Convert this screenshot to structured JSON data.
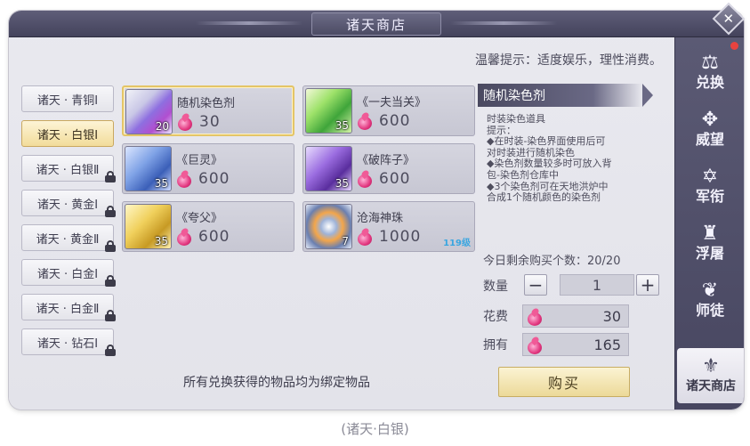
{
  "window": {
    "title": "诸天商店",
    "close_label": "✕"
  },
  "tip": "温馨提示：适度娱乐，理性消费。",
  "tiers": [
    {
      "label": "诸天 · 青铜Ⅰ",
      "locked": false,
      "active": false
    },
    {
      "label": "诸天 · 白银Ⅰ",
      "locked": false,
      "active": true
    },
    {
      "label": "诸天 · 白银Ⅱ",
      "locked": true,
      "active": false
    },
    {
      "label": "诸天 · 黄金Ⅰ",
      "locked": true,
      "active": false
    },
    {
      "label": "诸天 · 黄金Ⅱ",
      "locked": true,
      "active": false
    },
    {
      "label": "诸天 · 白金Ⅰ",
      "locked": true,
      "active": false
    },
    {
      "label": "诸天 · 白金Ⅱ",
      "locked": true,
      "active": false
    },
    {
      "label": "诸天 · 钻石Ⅰ",
      "locked": true,
      "active": false
    }
  ],
  "items": [
    {
      "name": "随机染色剂",
      "price": "30",
      "count": "20",
      "icon": "dye-potion-icon",
      "selected": true
    },
    {
      "name": "《一夫当关》",
      "price": "600",
      "count": "35",
      "icon": "green-book-icon",
      "selected": false
    },
    {
      "name": "《巨灵》",
      "price": "600",
      "count": "35",
      "icon": "blue-book-icon",
      "selected": false
    },
    {
      "name": "《破阵子》",
      "price": "600",
      "count": "35",
      "icon": "purple-book-icon",
      "selected": false
    },
    {
      "name": "《夸父》",
      "price": "600",
      "count": "35",
      "icon": "gold-book-icon",
      "selected": false
    },
    {
      "name": "沧海神珠",
      "price": "1000",
      "count": "7",
      "icon": "pearl-icon",
      "level": "119级",
      "selected": false
    }
  ],
  "detail": {
    "name": "随机染色剂",
    "description": [
      "时装染色道具",
      "提示：",
      "◆在时装-染色界面使用后可",
      "对时装进行随机染色",
      "◆染色剂数量较多时可放入背",
      "包-染色剂仓库中",
      "◆3个染色剂可在天地洪炉中",
      "合成1个随机颜色的染色剂"
    ],
    "remaining": "今日剩余购买个数：20/20",
    "qty_label": "数量",
    "qty_value": "1",
    "minus": "−",
    "plus": "+",
    "cost_label": "花费",
    "cost_value": "30",
    "own_label": "拥有",
    "own_value": "165"
  },
  "footer_note": "所有兑换获得的物品均为绑定物品",
  "buy_label": "购买",
  "sidenav": [
    {
      "label": "兑换",
      "glyph": "⚖",
      "icon": "scales-icon",
      "active": false
    },
    {
      "label": "威望",
      "glyph": "✥",
      "icon": "wings-icon",
      "active": false
    },
    {
      "label": "军衔",
      "glyph": "✡",
      "icon": "star-icon",
      "active": false
    },
    {
      "label": "浮屠",
      "glyph": "♜",
      "icon": "pagoda-icon",
      "active": false
    },
    {
      "label": "师徒",
      "glyph": "❦",
      "icon": "book-icon",
      "active": false
    },
    {
      "label": "诸天商店",
      "glyph": "⚜",
      "icon": "shop-emblem-icon",
      "active": true
    }
  ],
  "caption": "(诸天·白银)",
  "colors": {
    "accent_gold": "#e4c567",
    "nav_bg": "#4f4e68",
    "gem": "#e2357e",
    "level": "#3aa6e0"
  }
}
